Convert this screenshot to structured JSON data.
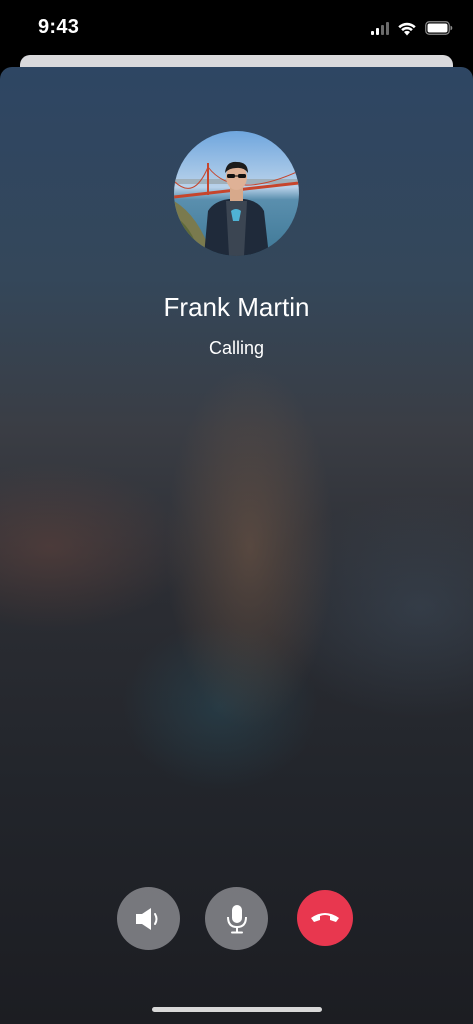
{
  "status_bar": {
    "time": "9:43",
    "icons": [
      "cellular-signal-icon",
      "wifi-icon",
      "battery-icon"
    ]
  },
  "call": {
    "caller_name": "Frank Martin",
    "status": "Calling"
  },
  "controls": [
    {
      "name": "speaker",
      "icon": "speaker-icon"
    },
    {
      "name": "mute",
      "icon": "microphone-icon"
    },
    {
      "name": "end-call",
      "icon": "hang-up-icon",
      "color": "#e8374f"
    }
  ],
  "colors": {
    "end_call": "#e8374f",
    "control_gray": "#96969b",
    "text": "#ffffff"
  }
}
